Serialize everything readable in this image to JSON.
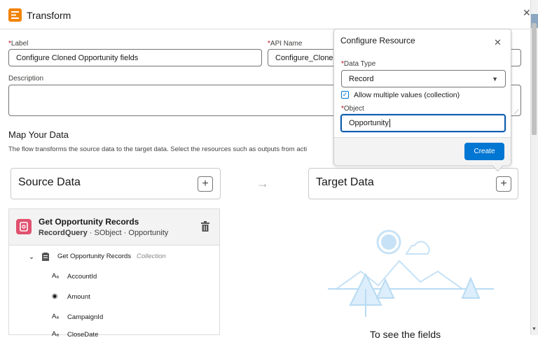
{
  "header": {
    "title": "Transform"
  },
  "form": {
    "label_caption": "Label",
    "label_value": "Configure Cloned Opportunity fields",
    "api_caption": "API Name",
    "api_value": "Configure_Cloned_",
    "description_caption": "Description",
    "description_value": ""
  },
  "map": {
    "title": "Map Your Data",
    "description": "The flow transforms the source data to the target data. Select the resources such as outputs from acti"
  },
  "source": {
    "title": "Source Data"
  },
  "target": {
    "title": "Target Data",
    "empty_text": "To see the fields"
  },
  "record": {
    "title": "Get Opportunity Records",
    "type_label": "RecordQuery",
    "sub_rest": "SObject · Opportunity",
    "tree_root": "Get Opportunity Records",
    "tree_root_tag": "Collection",
    "fields": [
      {
        "icon": "Aₐ",
        "name": "AccountId"
      },
      {
        "icon": "◉",
        "name": "Amount"
      },
      {
        "icon": "Aₐ",
        "name": "CampaignId"
      },
      {
        "icon": "Aₐ",
        "name": "CloseDate"
      }
    ]
  },
  "popover": {
    "title": "Configure Resource",
    "data_type_caption": "Data Type",
    "data_type_value": "Record",
    "allow_multiple_label": "Allow multiple values (collection)",
    "object_caption": "Object",
    "object_value": "Opportunity",
    "create_label": "Create"
  },
  "colors": {
    "accent": "#0176d3",
    "header_icon": "#f38303",
    "record_icon": "#e0526f"
  }
}
